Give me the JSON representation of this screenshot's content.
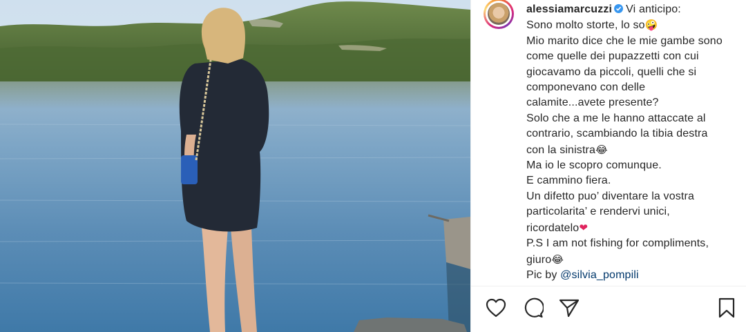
{
  "post": {
    "username": "alessiamarcuzzi",
    "verified_icon": "verified-badge-icon",
    "caption_lines": [
      "Vi anticipo:",
      "Sono molto storte, lo so",
      "Mio marito dice che le mie gambe sono",
      "come quelle dei pupazzetti con cui",
      "giocavamo da piccoli, quelli che si",
      "componevano con delle",
      "calamite...avete presente?",
      "Solo che a me le hanno attaccate al",
      "contrario, scambiando la tibia destra",
      "con la sinistra",
      "Ma io le scopro comunque.",
      "E cammino fiera.",
      "Un difetto puo’ diventare la vostra",
      "particolarita’ e rendervi unici,",
      "ricordatelo",
      "P.S I am not fishing for compliments,",
      "giuro",
      "Pic by "
    ],
    "emojis": {
      "zany_face": "🤪",
      "laughing_1": "😂",
      "red_heart": "❤",
      "laughing_2": "😂"
    },
    "mention": "@silvia_pompili"
  },
  "actions": {
    "like_icon": "heart-icon",
    "comment_icon": "comment-icon",
    "share_icon": "paper-plane-icon",
    "save_icon": "bookmark-icon"
  },
  "colors": {
    "verified": "#3897f0",
    "mention": "#00376b",
    "text": "#262626",
    "divider": "#efefef"
  }
}
